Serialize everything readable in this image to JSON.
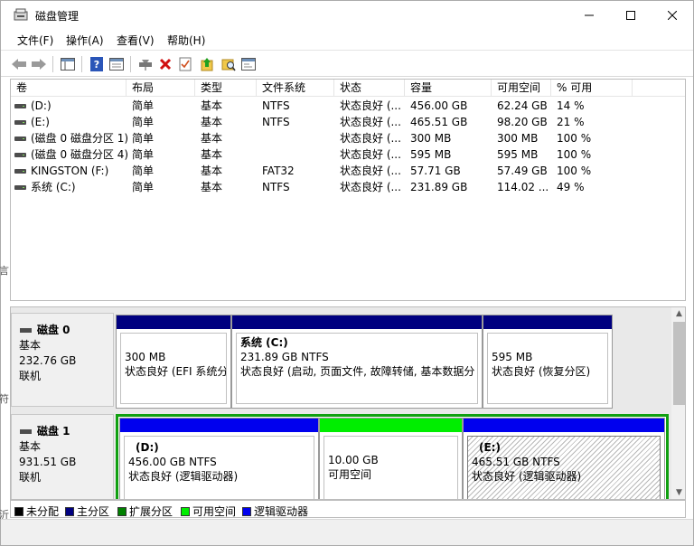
{
  "window": {
    "title": "磁盘管理"
  },
  "menu": [
    "文件(F)",
    "操作(A)",
    "查看(V)",
    "帮助(H)"
  ],
  "volumes": {
    "headers": [
      "卷",
      "布局",
      "类型",
      "文件系统",
      "状态",
      "容量",
      "可用空间",
      "% 可用"
    ],
    "rows": [
      [
        "(D:)",
        "简单",
        "基本",
        "NTFS",
        "状态良好 (...",
        "456.00 GB",
        "62.24 GB",
        "14 %"
      ],
      [
        "(E:)",
        "简单",
        "基本",
        "NTFS",
        "状态良好 (...",
        "465.51 GB",
        "98.20 GB",
        "21 %"
      ],
      [
        "(磁盘 0 磁盘分区 1)",
        "简单",
        "基本",
        "",
        "状态良好 (...",
        "300 MB",
        "300 MB",
        "100 %"
      ],
      [
        "(磁盘 0 磁盘分区 4)",
        "简单",
        "基本",
        "",
        "状态良好 (...",
        "595 MB",
        "595 MB",
        "100 %"
      ],
      [
        "KINGSTON (F:)",
        "简单",
        "基本",
        "FAT32",
        "状态良好 (...",
        "57.71 GB",
        "57.49 GB",
        "100 %"
      ],
      [
        "系统 (C:)",
        "简单",
        "基本",
        "NTFS",
        "状态良好 (...",
        "231.89 GB",
        "114.02 ...",
        "49 %"
      ]
    ]
  },
  "disks": [
    {
      "name": "磁盘 0",
      "type": "基本",
      "size": "232.76 GB",
      "status": "联机",
      "partitions": [
        {
          "title": "",
          "size": "300 MB",
          "status": "状态良好 (EFI 系统分"
        },
        {
          "title": "系统 (C:)",
          "size": "231.89 GB NTFS",
          "status": "状态良好 (启动, 页面文件, 故障转储, 基本数据分"
        },
        {
          "title": "",
          "size": "595 MB",
          "status": "状态良好 (恢复分区)"
        }
      ]
    },
    {
      "name": "磁盘 1",
      "type": "基本",
      "size": "931.51 GB",
      "status": "联机",
      "partitions": [
        {
          "title": "(D:)",
          "size": "456.00 GB NTFS",
          "status": "状态良好 (逻辑驱动器)"
        },
        {
          "title": "",
          "size": "10.00 GB",
          "status": "可用空间"
        },
        {
          "title": "(E:)",
          "size": "465.51 GB NTFS",
          "status": "状态良好 (逻辑驱动器)"
        }
      ]
    }
  ],
  "legend": [
    {
      "label": "未分配",
      "color": "#000000"
    },
    {
      "label": "主分区",
      "color": "#000080"
    },
    {
      "label": "扩展分区",
      "color": "#008000"
    },
    {
      "label": "可用空间",
      "color": "#00ee00"
    },
    {
      "label": "逻辑驱动器",
      "color": "#0000ee"
    }
  ],
  "colors": {
    "primary": "#000080",
    "logical": "#0000ee",
    "free": "#00ee00",
    "extended": "#10a010"
  }
}
